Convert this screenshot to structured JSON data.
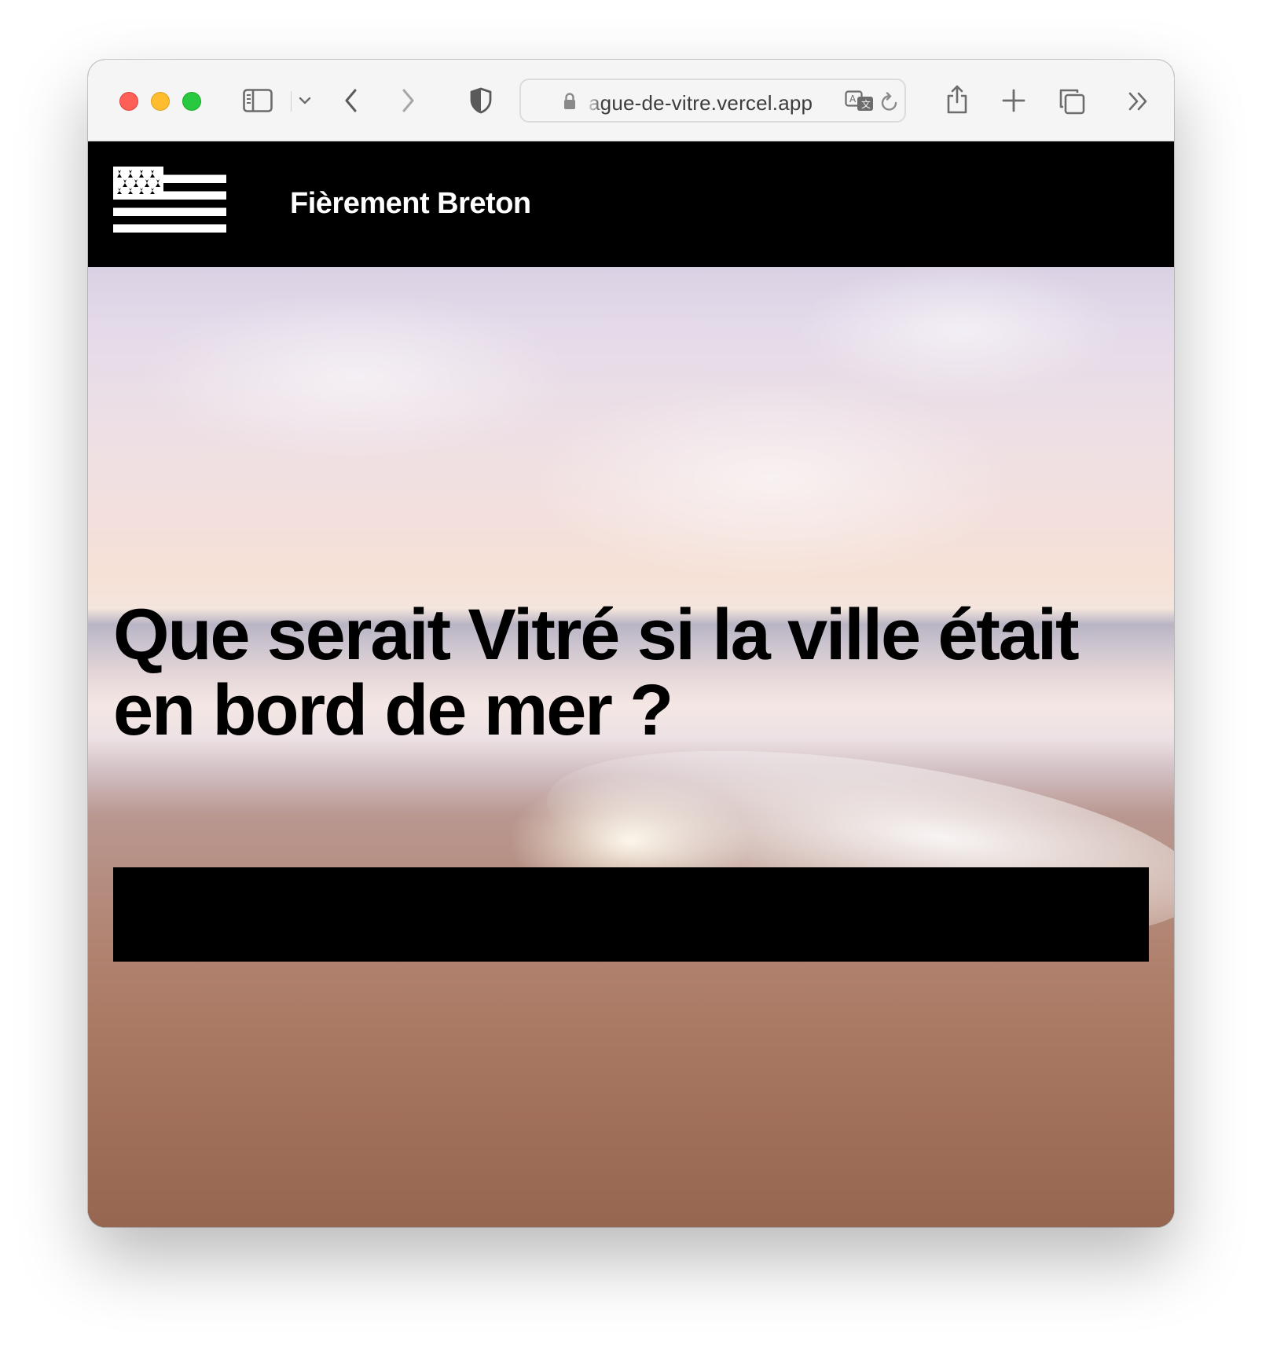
{
  "browser": {
    "url_display": "ague-de-vitre.vercel.app",
    "icons": [
      "sidebar-icon",
      "chevron-down-icon",
      "back-icon",
      "forward-icon",
      "shield-icon",
      "lock-icon",
      "translate-icon",
      "reload-icon",
      "share-icon",
      "new-tab-icon",
      "tabs-overview-icon",
      "more-icon"
    ]
  },
  "site": {
    "logo": "breton-flag",
    "title": "Fièrement Breton"
  },
  "hero": {
    "headline": "Que serait Vitré si la ville était en bord de mer ?",
    "redacted_block": true
  },
  "colors": {
    "header_bg": "#000000",
    "header_text": "#ffffff",
    "headline_text": "#000000"
  }
}
